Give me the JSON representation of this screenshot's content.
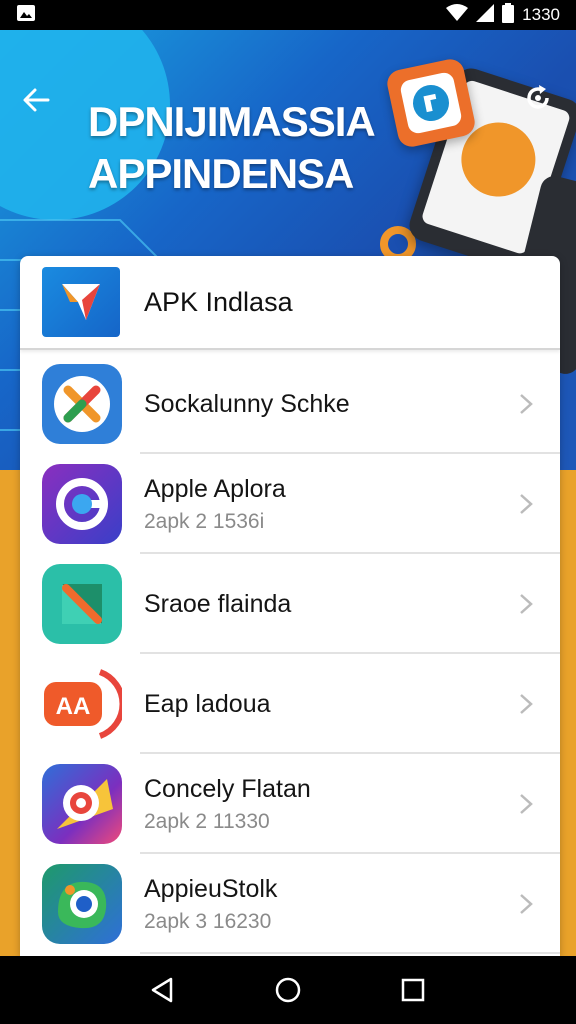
{
  "status_bar": {
    "time": "1330"
  },
  "hero": {
    "title_line1": "DPNIJIMASSIA",
    "title_line2": "APPINDENSA"
  },
  "list": {
    "header_title": "APK Indlasa",
    "items": [
      {
        "name": "Sockalunny Schke",
        "sub": "",
        "icon": "x-logo-icon"
      },
      {
        "name": "Apple Aplora",
        "sub": "2apk 2 1536i",
        "icon": "g-swirl-icon"
      },
      {
        "name": "Sraoe flainda",
        "sub": "",
        "icon": "green-fold-icon"
      },
      {
        "name": "Eap ladoua",
        "sub": "",
        "icon": "aa-logo-icon"
      },
      {
        "name": "Concely Flatan",
        "sub": "2apk 2 11330",
        "icon": "chrome-like-icon"
      },
      {
        "name": "AppieuStolk",
        "sub": "2apk 3 16230",
        "icon": "camera-blob-icon"
      }
    ]
  },
  "colors": {
    "hero_blue": "#1766c8",
    "accent_orange": "#f0962a",
    "background_orange": "#e9a22a"
  }
}
